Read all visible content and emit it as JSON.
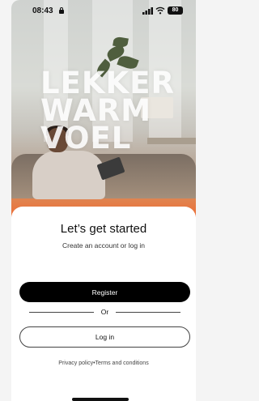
{
  "status_bar": {
    "time": "08:43",
    "battery": "80"
  },
  "hero": {
    "headline_lines": [
      "LEKKER",
      "WARM",
      "VOEL"
    ]
  },
  "onboarding": {
    "title": "Let’s get started",
    "subtitle": "Create an account or log in",
    "register_label": "Register",
    "or_label": "Or",
    "login_label": "Log in"
  },
  "footer": {
    "privacy_label": "Privacy policy",
    "separator": "•",
    "terms_label": "Terms and conditions"
  },
  "colors": {
    "primary_button": "#000000",
    "hero_gradient_bottom": "#ee6d35"
  },
  "icons": [
    "lock-icon",
    "signal-icon",
    "wifi-icon",
    "battery-icon"
  ]
}
